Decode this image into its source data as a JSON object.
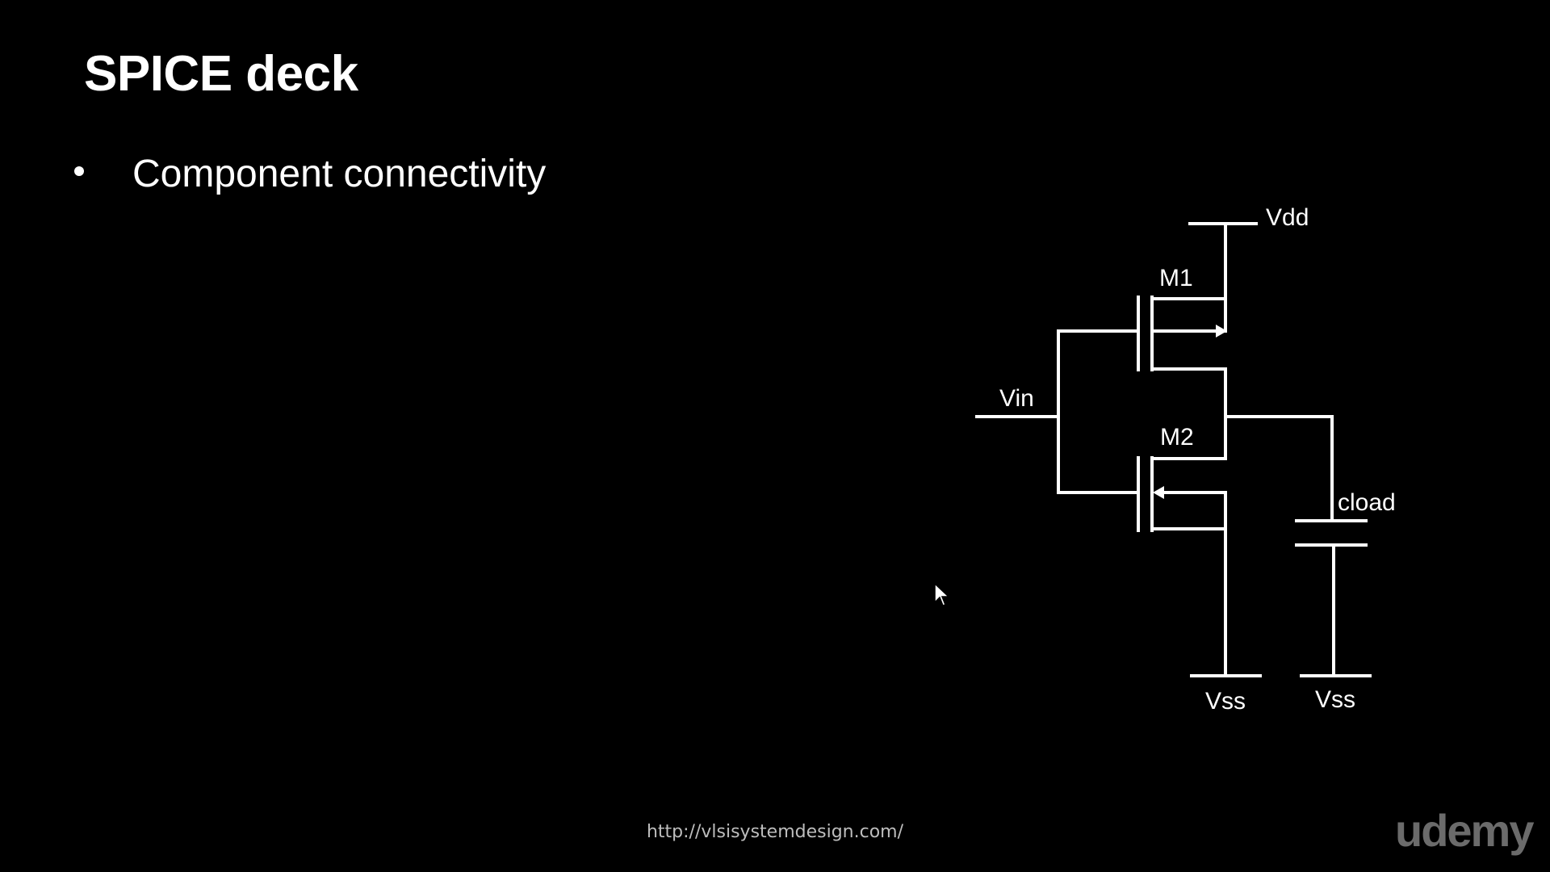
{
  "slide": {
    "title": "SPICE deck",
    "bullets": [
      "Component connectivity"
    ]
  },
  "circuit": {
    "labels": {
      "vdd": "Vdd",
      "m1": "M1",
      "vin": "Vin",
      "m2": "M2",
      "cload": "cload",
      "vss_left": "Vss",
      "vss_right": "Vss"
    }
  },
  "footer": {
    "url": "http://vlsisystemdesign.com/",
    "brand": "udemy"
  },
  "colors": {
    "background": "#000000",
    "foreground": "#ffffff",
    "footer_text": "#bdbdbd",
    "brand": "#6b6b6b"
  },
  "icons": {
    "cursor": "mouse-pointer-icon",
    "bullet": "bullet-dot-icon"
  }
}
